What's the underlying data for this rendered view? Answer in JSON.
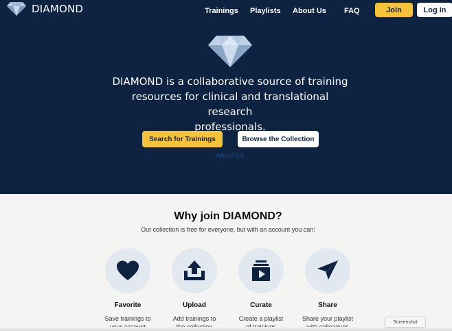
{
  "nav": {
    "logo_text": "DIAMOND",
    "links": {
      "trainings": "Trainings",
      "playlists": "Playlists",
      "about": "About Us",
      "faq": "FAQ"
    },
    "join": "Join",
    "login": "Log in"
  },
  "hero": {
    "tagline_lines": [
      "DIAMOND is a collaborative source of training",
      "resources for clinical and translational research",
      "professionals."
    ],
    "search_button": "Search for Trainings",
    "browse_button": "Browse the Collection",
    "about_link": "About Us"
  },
  "why": {
    "title": "Why join DIAMOND?",
    "subtitle": "Our collection is free for everyone, but with an account you can:",
    "features": [
      {
        "icon": "heart-icon",
        "title": "Favorite",
        "desc": [
          "Save trainings to",
          "your account"
        ]
      },
      {
        "icon": "upload-icon",
        "title": "Upload",
        "desc": [
          "Add trainings to",
          "the collection"
        ]
      },
      {
        "icon": "playlist-icon",
        "title": "Curate",
        "desc": [
          "Create a playlist",
          "of trainings"
        ]
      },
      {
        "icon": "send-icon",
        "title": "Share",
        "desc": [
          "Share your playlist",
          "with colleagues"
        ]
      }
    ]
  },
  "overlay": {
    "screenshot_label": "Screenshot"
  },
  "colors": {
    "navy": "#0e2342",
    "gold": "#f6c338",
    "icon_circle": "#e2e8ef",
    "link_blue": "#1f4c86"
  }
}
